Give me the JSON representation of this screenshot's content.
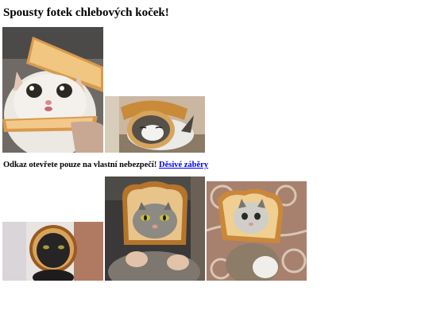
{
  "page": {
    "title": "Spousty fotek chlebových koček!",
    "warning_text": "Odkaz otevřete pouze na vlastní nebezpečí!",
    "warning_link": "Děsivé záběry"
  },
  "photos": [
    {
      "alt": "fluffy white cat with bread slice around head"
    },
    {
      "alt": "tabby cat lying with bread crust around head"
    },
    {
      "alt": "dark cat with burnt bread crust ring"
    },
    {
      "alt": "grey tabby cat with face in a slice of bread"
    },
    {
      "alt": "kitten with bread slice around head on rug"
    }
  ]
}
